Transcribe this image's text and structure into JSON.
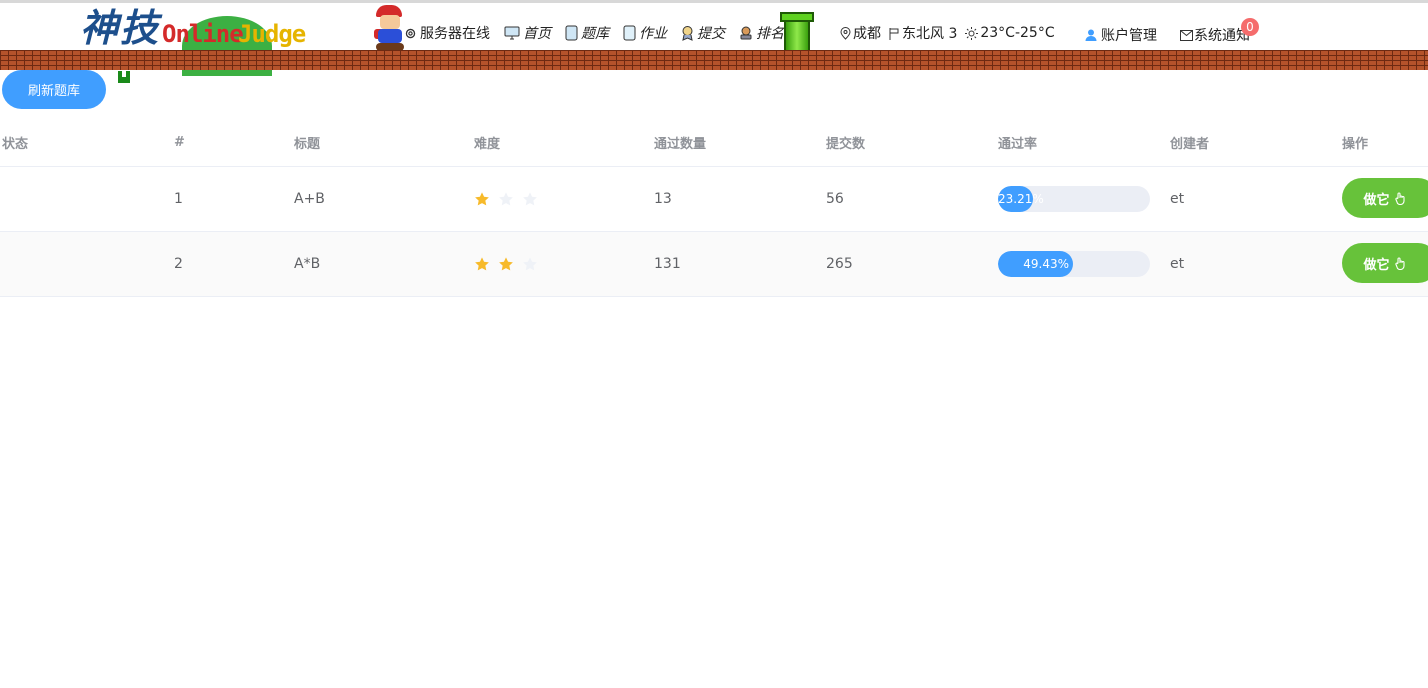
{
  "header": {
    "logo": {
      "hanzi": "神技",
      "online": "Online",
      "judge": "Judge"
    },
    "nav": [
      {
        "icon": "gear-icon",
        "label": "服务器在线"
      },
      {
        "icon": "monitor-icon",
        "label": "首页"
      },
      {
        "icon": "book-icon",
        "label": "题库"
      },
      {
        "icon": "tablet-icon",
        "label": "作业"
      },
      {
        "icon": "medal-icon",
        "label": "提交"
      },
      {
        "icon": "rank-icon",
        "label": "排名"
      }
    ],
    "weather": {
      "city": "成都",
      "wind": "东北风 3",
      "temp": "23°C-25°C"
    },
    "account_label": "账户管理",
    "notify_label": "系统通知",
    "notify_count": "0"
  },
  "toolbar": {
    "refresh_label": "刷新题库"
  },
  "table": {
    "headers": {
      "status": "状态",
      "id": "#",
      "title": "标题",
      "difficulty": "难度",
      "accepted": "通过数量",
      "submissions": "提交数",
      "rate": "通过率",
      "author": "创建者",
      "operation": "操作"
    },
    "rows": [
      {
        "status": "",
        "id": "1",
        "title": "A+B",
        "difficulty": 1,
        "accepted": "13",
        "submissions": "56",
        "rate_text": "23.21%",
        "rate": 0.2321,
        "author": "et",
        "action": "做它"
      },
      {
        "status": "",
        "id": "2",
        "title": "A*B",
        "difficulty": 2,
        "accepted": "131",
        "submissions": "265",
        "rate_text": "49.43%",
        "rate": 0.4943,
        "author": "et",
        "action": "做它"
      }
    ],
    "max_stars": 3
  },
  "colors": {
    "primary": "#409eff",
    "success": "#67c23a",
    "danger": "#f56c6c",
    "star_on": "#f7ba2a",
    "star_off": "#eff2f7"
  }
}
